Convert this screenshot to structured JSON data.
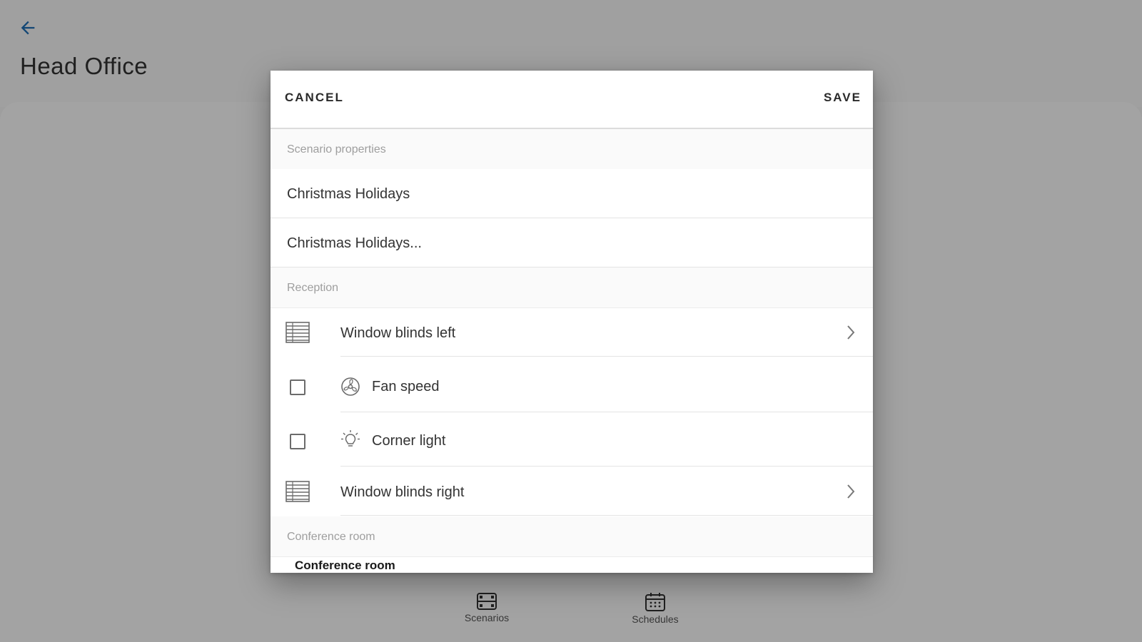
{
  "app": {
    "page_title": "Head Office",
    "accent_color": "#1e6fb8"
  },
  "bottom_nav": {
    "items": [
      {
        "label": "Scenarios",
        "icon": "film-icon"
      },
      {
        "label": "Schedules",
        "icon": "calendar-icon"
      }
    ]
  },
  "dialog": {
    "cancel_label": "CANCEL",
    "save_label": "SAVE",
    "sections": {
      "properties": {
        "header": "Scenario properties",
        "name_value": "Christmas Holidays",
        "description_value": "Christmas Holidays..."
      },
      "reception": {
        "header": "Reception",
        "devices": [
          {
            "label": "Window blinds left",
            "icon": "blinds-icon",
            "type": "navigable"
          },
          {
            "label": "Fan speed",
            "icon": "fan-icon",
            "type": "checkbox",
            "checked": false
          },
          {
            "label": "Corner light",
            "icon": "bulb-icon",
            "type": "checkbox",
            "checked": false
          },
          {
            "label": "Window blinds right",
            "icon": "blinds-icon",
            "type": "navigable"
          }
        ]
      },
      "conference": {
        "header": "Conference room",
        "peek_label": "Conference room"
      }
    }
  }
}
